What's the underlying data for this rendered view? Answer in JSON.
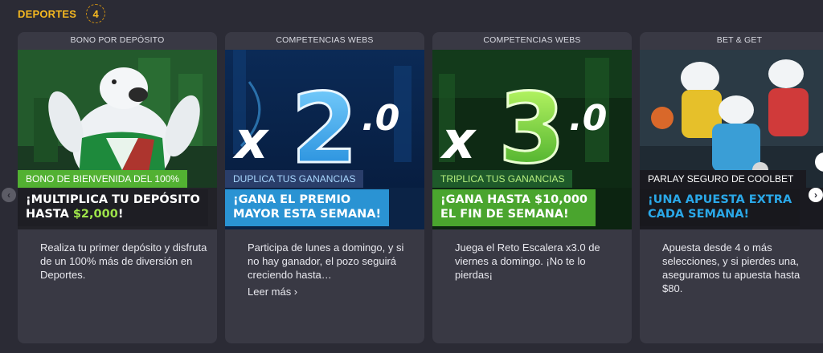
{
  "section": {
    "title": "DEPORTES",
    "count": "4"
  },
  "cards": [
    {
      "category": "BONO POR DEPÓSITO",
      "tag": "BONO DE BIENVENIDA DEL 100%",
      "headline_line1": "¡MULTIPLICA TU DEPÓSITO",
      "headline_line2_prefix": "HASTA ",
      "headline_line2_amount": "$2,000",
      "headline_line2_suffix": "!",
      "description": "Realiza tu primer depósito y disfruta de un 100% más de diversión en Deportes.",
      "tag_color": "#52b132"
    },
    {
      "category": "COMPETENCIAS WEBS",
      "banner_prefix": "x",
      "banner_number": "2",
      "banner_decimal": ".0",
      "tag": "DUPLICA TUS GANANCIAS",
      "headline_line1": "¡GANA EL PREMIO",
      "headline_line2": "MAYOR ESTA SEMANA!",
      "description": "Participa de lunes a domingo, y si no hay ganador, el pozo seguirá creciendo hasta…",
      "more_link": "Leer más ›",
      "tag_color": "#2a3e6a"
    },
    {
      "category": "COMPETENCIAS WEBS",
      "banner_prefix": "x",
      "banner_number": "3",
      "banner_decimal": ".0",
      "tag": "TRIPLICA TUS GANANCIAS",
      "headline_line1": "¡GANA HASTA $10,000",
      "headline_line2": "EL FIN DE SEMANA!",
      "description": "Juega el Reto Escalera x3.0 de viernes a domingo. ¡No te lo pierdas¡",
      "tag_color": "#1e5a2a"
    },
    {
      "category": "BET & GET",
      "tag": "PARLAY SEGURO DE COOLBET",
      "headline_line1": "¡UNA APUESTA EXTRA",
      "headline_line2": "CADA SEMANA!",
      "description": "Apuesta desde 4 o más selecciones, y si pierdes una, aseguramos tu apuesta hasta $80.",
      "tag_color": "#1a1a20"
    }
  ],
  "colors": {
    "accent": "#f5b820",
    "card_bg": "#393944",
    "page_bg": "#2b2b35",
    "green": "#52b132",
    "blue": "#2a93d3"
  }
}
